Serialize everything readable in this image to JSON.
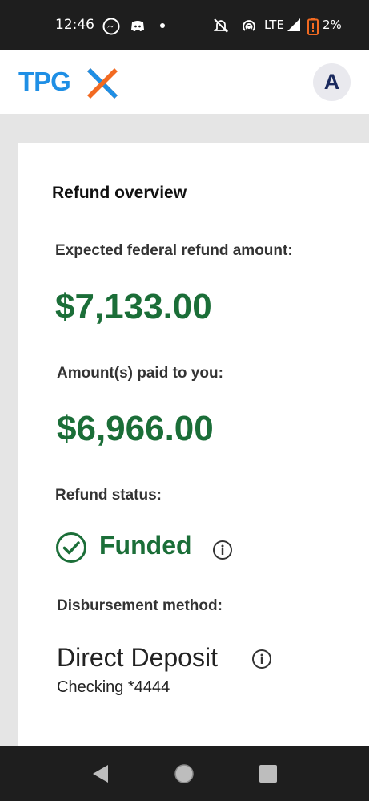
{
  "status_bar": {
    "time": "12:46",
    "network": "LTE",
    "battery": "2%",
    "icons": [
      "messenger-icon",
      "discord-icon",
      "notification-dot",
      "bell-off-icon",
      "hotspot-icon",
      "signal-icon",
      "battery-low-icon"
    ]
  },
  "header": {
    "logo_text": "TPG",
    "avatar_initial": "A"
  },
  "card": {
    "title": "Refund overview",
    "expected_label": "Expected federal refund amount:",
    "expected_amount": "$7,133.00",
    "paid_label": "Amount(s) paid to you:",
    "paid_amount": "$6,966.00",
    "status_label": "Refund status:",
    "status_value": "Funded",
    "method_label": "Disbursement method:",
    "method_value": "Direct Deposit",
    "account_value": "Checking *4444"
  },
  "colors": {
    "brand_blue": "#1f8fe5",
    "brand_orange": "#f26a21",
    "success_green": "#1b6e38"
  },
  "nav": [
    "back-button",
    "home-button",
    "recents-button"
  ]
}
